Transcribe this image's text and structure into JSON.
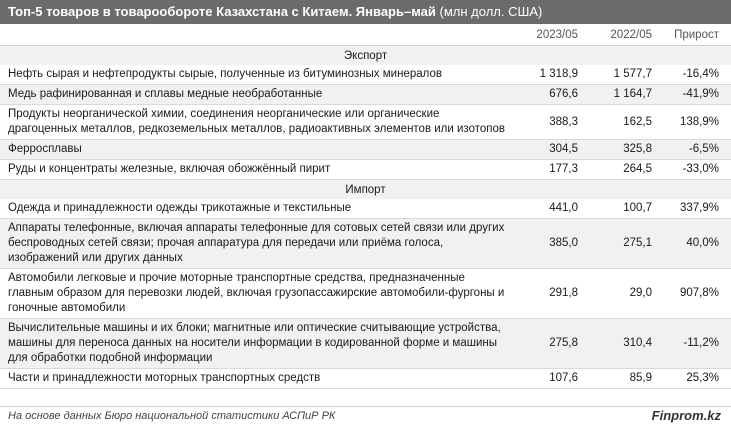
{
  "title": {
    "main": "Топ-5 товаров в товарообороте Казахстана с Китаем. Январь–май",
    "unit": "(млн долл. США)"
  },
  "columns": [
    "",
    "2023/05",
    "2022/05",
    "Прирост"
  ],
  "sections": [
    {
      "label": "Экспорт",
      "rows": [
        {
          "name": "Нефть сырая и нефтепродукты сырые, полученные из битуминозных минералов",
          "v2023": "1 318,9",
          "v2022": "1 577,7",
          "growth": "-16,4%"
        },
        {
          "name": "Медь рафинированная и сплавы медные необработанные",
          "v2023": "676,6",
          "v2022": "1 164,7",
          "growth": "-41,9%"
        },
        {
          "name": "Продукты неорганической химии, соединения неорганические или органические драгоценных металлов, редкоземельных металлов, радиоактивных элементов или изотопов",
          "v2023": "388,3",
          "v2022": "162,5",
          "growth": "138,9%"
        },
        {
          "name": "Ферросплавы",
          "v2023": "304,5",
          "v2022": "325,8",
          "growth": "-6,5%"
        },
        {
          "name": "Руды и концентраты железные, включая обожжённый пирит",
          "v2023": "177,3",
          "v2022": "264,5",
          "growth": "-33,0%"
        }
      ]
    },
    {
      "label": "Импорт",
      "rows": [
        {
          "name": "Одежда и принадлежности одежды трикотажные и текстильные",
          "v2023": "441,0",
          "v2022": "100,7",
          "growth": "337,9%"
        },
        {
          "name": "Аппараты телефонные, включая аппараты телефонные для сотовых сетей связи или других беспроводных сетей связи; прочая аппаратура для передачи или приёма голоса, изображений или других данных",
          "v2023": "385,0",
          "v2022": "275,1",
          "growth": "40,0%"
        },
        {
          "name": "Автомобили легковые и прочие моторные транспортные средства, предназначенные главным образом для перевозки людей, включая грузопассажирские автомобили-фургоны и гоночные автомобили",
          "v2023": "291,8",
          "v2022": "29,0",
          "growth": "907,8%"
        },
        {
          "name": "Вычислительные машины и их блоки; магнитные или оптические считывающие устройства, машины для переноса данных на носители информации в кодированной форме и машины для обработки подобной информации",
          "v2023": "275,8",
          "v2022": "310,4",
          "growth": "-11,2%"
        },
        {
          "name": "Части и принадлежности моторных транспортных средств",
          "v2023": "107,6",
          "v2022": "85,9",
          "growth": "25,3%"
        }
      ]
    }
  ],
  "footer": {
    "source": "На основе данных Бюро национальной статистики АСПиР РК",
    "brand": "Finprom.kz"
  }
}
